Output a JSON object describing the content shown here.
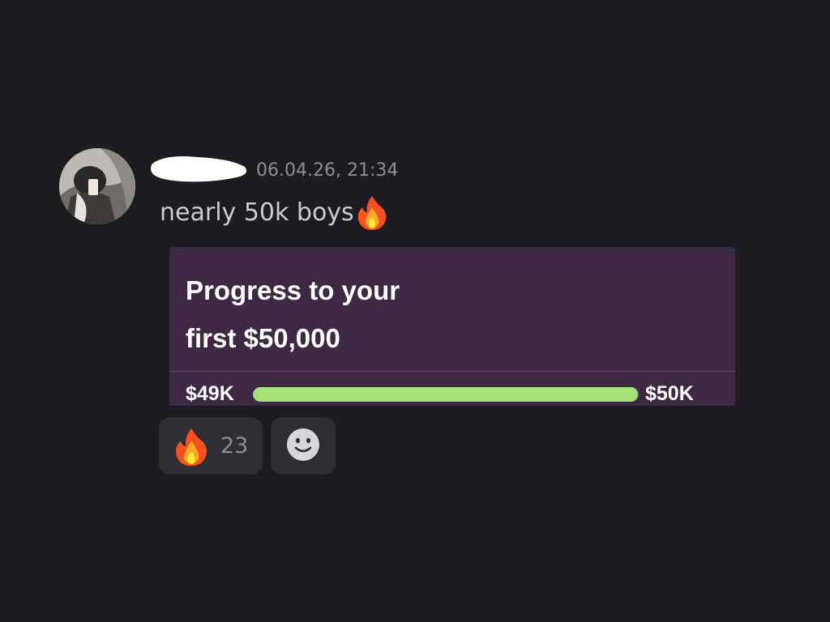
{
  "message": {
    "timestamp": "06.04.26, 21:34",
    "text": "nearly 50k boys",
    "text_emoji": "fire-emoji"
  },
  "embed": {
    "title_line1": "Progress to your",
    "title_line2": "first $50,000",
    "progress": {
      "start_label": "$49K",
      "end_label": "$50K",
      "fill_fraction": 0.995,
      "track_color": "#5a4a60",
      "fill_color": "#a4e37a"
    },
    "background_color": "#3e2844"
  },
  "reactions": [
    {
      "emoji": "fire-emoji",
      "count": "23"
    }
  ],
  "add_reaction_icon": "smiley-face-icon",
  "colors": {
    "background": "#1c1c21",
    "reaction_pill": "#2e2e34",
    "muted_text": "#8d8d93"
  }
}
